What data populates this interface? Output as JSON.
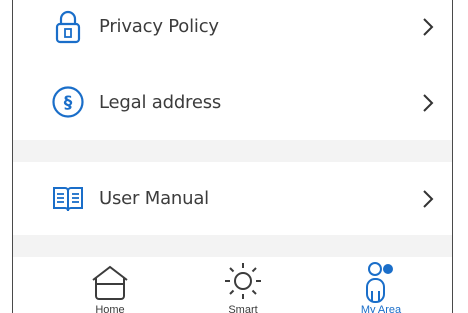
{
  "menu": {
    "items": [
      {
        "label": "Privacy Policy",
        "icon": "lock-icon"
      },
      {
        "label": "Legal address",
        "icon": "section-sign-icon",
        "icon_glyph": "§"
      },
      {
        "label": "User Manual",
        "icon": "book-icon"
      }
    ],
    "chevron_icon": "chevron-right-icon"
  },
  "tabbar": {
    "tabs": [
      {
        "label": "Home",
        "icon": "home-icon"
      },
      {
        "label": "Smart",
        "icon": "sun-icon"
      },
      {
        "label": "My Area",
        "icon": "user-icon",
        "active": true
      }
    ]
  },
  "colors": {
    "accent": "#1a6ec9",
    "text": "#3c3c3c",
    "separator": "#f3f3f3",
    "chevron": "#333333"
  }
}
